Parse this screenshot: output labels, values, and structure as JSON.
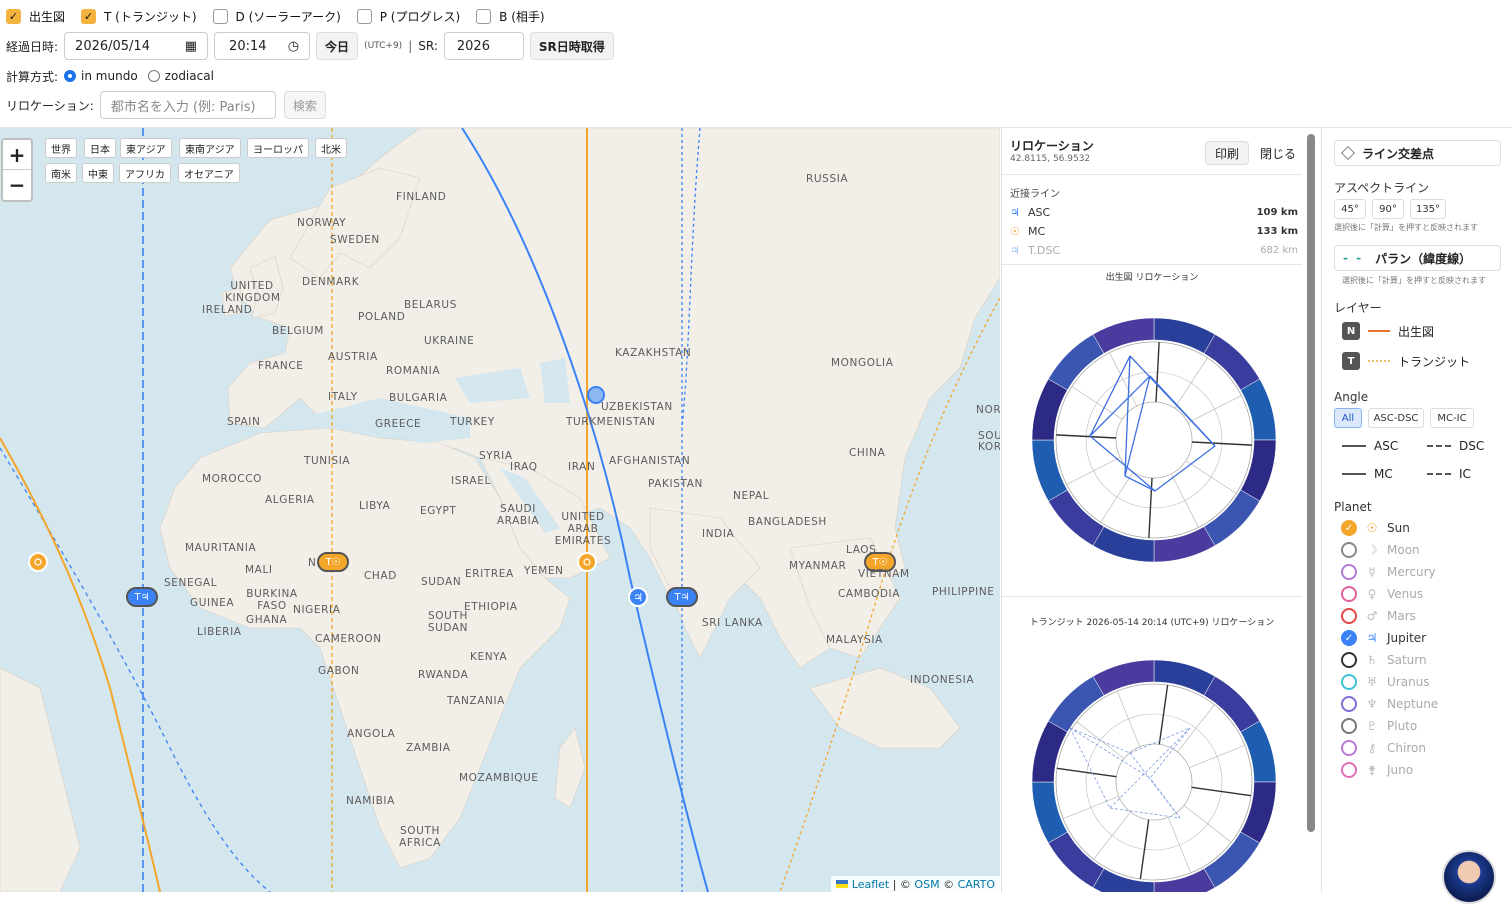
{
  "toolbar": {
    "chart_toggles": [
      {
        "label": "出生図",
        "checked": true
      },
      {
        "label": "T (トランジット)",
        "checked": true
      },
      {
        "label": "D (ソーラーアーク)",
        "checked": false
      },
      {
        "label": "P (プログレス)",
        "checked": false
      },
      {
        "label": "B (相手)",
        "checked": false
      }
    ],
    "date_label": "経過日時:",
    "date_value": "2026/05/14",
    "time_value": "20:14",
    "today_button": "今日",
    "tz": "(UTC+9)",
    "sep": "|",
    "sr_label": "SR:",
    "sr_value": "2026",
    "sr_button": "SR日時取得",
    "calc_label": "計算方式:",
    "calc_options": [
      "in mundo",
      "zodiacal"
    ],
    "reloc_label": "リロケーション:",
    "reloc_placeholder": "都市名を入力 (例: Paris)",
    "search_button": "検索"
  },
  "map": {
    "zoom_in": "+",
    "zoom_out": "−",
    "region_buttons_row1": [
      "世界",
      "日本",
      "東アジア",
      "東南アジア",
      "ヨーロッパ",
      "北米"
    ],
    "region_buttons_row2": [
      "南米",
      "中東",
      "アフリカ",
      "オセアニア"
    ],
    "labels": [
      "RUSSIA",
      "FINLAND",
      "NORWAY",
      "SWEDEN",
      "UNITED KINGDOM",
      "IRELAND",
      "DENMARK",
      "BELARUS",
      "POLAND",
      "UKRAINE",
      "BELGIUM",
      "FRANCE",
      "AUSTRIA",
      "ROMANIA",
      "ITALY",
      "BULGARIA",
      "GREECE",
      "SPAIN",
      "TURKEY",
      "KAZAKHSTAN",
      "UZBEKISTAN",
      "TURKMENISTAN",
      "MONGOLIA",
      "NOR",
      "SOU",
      "KOR",
      "CHINA",
      "TUNISIA",
      "SYRIA",
      "IRAQ",
      "IRAN",
      "AFGHANISTAN",
      "MOROCCO",
      "ALGERIA",
      "LIBYA",
      "EGYPT",
      "ISRAEL",
      "SAUDI ARABIA",
      "UNITED ARAB EMIRATES",
      "PAKISTAN",
      "NEPAL",
      "BANGLADESH",
      "INDIA",
      "MAURITANIA",
      "MALI",
      "NI",
      "CHAD",
      "SUDAN",
      "ERITREA",
      "YEMEN",
      "SENEGAL",
      "GUINEA",
      "BURKINA FASO",
      "NIGERIA",
      "ETHIOPIA",
      "SOUTH SUDAN",
      "GHANA",
      "LIBERIA",
      "CAMEROON",
      "GABON",
      "KENYA",
      "RWANDA",
      "TANZANIA",
      "ANGOLA",
      "ZAMBIA",
      "MOZAMBIQUE",
      "NAMIBIA",
      "SOUTH AFRICA",
      "MYANMAR",
      "LAOS",
      "VIETNAM",
      "CAMBODIA",
      "PHILIPPINE",
      "SRI LANKA",
      "MALAYSIA",
      "INDONESIA"
    ],
    "markers": [
      "T☉",
      "T♃",
      "T♃",
      "T☉"
    ],
    "attribution": {
      "leaflet": "Leaflet",
      "sep1": "| ©",
      "osm": "OSM",
      "sep2": "©",
      "carto": "CARTO"
    }
  },
  "relocation_panel": {
    "title": "リロケーション",
    "coords": "42.8115, 56.9532",
    "print_button": "印刷",
    "close_button": "閉じる",
    "nearby_title": "近接ライン",
    "nearby": [
      {
        "glyph": "♃",
        "name": "ASC",
        "dist": "109 km"
      },
      {
        "glyph": "☉",
        "name": "MC",
        "dist": "133 km"
      },
      {
        "glyph": "♃",
        "name": "T.DSC",
        "dist": "682 km"
      }
    ],
    "chart1_title": "出生図 リロケーション",
    "chart2_title": "トランジット 2026-05-14 20:14 (UTC+9) リロケーション"
  },
  "right_panel": {
    "intersect_button": "ライン交差点",
    "aspect_title": "アスペクトライン",
    "aspect_buttons": [
      "45°",
      "90°",
      "135°"
    ],
    "aspect_note": "選択後に「計算」を押すと反映されます",
    "paran_button": "パラン（緯度線）",
    "paran_note": "選択後に「計算」を押すと反映されます",
    "layer_title": "レイヤー",
    "layers": [
      {
        "badge": "N",
        "label": "出生図"
      },
      {
        "badge": "T",
        "label": "トランジット"
      }
    ],
    "angle_title": "Angle",
    "angle_buttons": [
      "All",
      "ASC-DSC",
      "MC-IC"
    ],
    "angle_legend": [
      "ASC",
      "DSC",
      "MC",
      "IC"
    ],
    "planet_title": "Planet",
    "planets": [
      {
        "name": "Sun",
        "glyph": "☉",
        "color": "#f4a62a",
        "on": true
      },
      {
        "name": "Moon",
        "glyph": "☽",
        "color": "#888888",
        "on": false
      },
      {
        "name": "Mercury",
        "glyph": "☿",
        "color": "#b47ad6",
        "on": false
      },
      {
        "name": "Venus",
        "glyph": "♀",
        "color": "#e0609a",
        "on": false
      },
      {
        "name": "Mars",
        "glyph": "♂",
        "color": "#e04848",
        "on": false
      },
      {
        "name": "Jupiter",
        "glyph": "♃",
        "color": "#3b82f6",
        "on": true
      },
      {
        "name": "Saturn",
        "glyph": "♄",
        "color": "#333333",
        "on": false
      },
      {
        "name": "Uranus",
        "glyph": "♅",
        "color": "#3fc1d6",
        "on": false
      },
      {
        "name": "Neptune",
        "glyph": "♆",
        "color": "#7c6fd6",
        "on": false
      },
      {
        "name": "Pluto",
        "glyph": "♇",
        "color": "#777777",
        "on": false
      },
      {
        "name": "Chiron",
        "glyph": "⚷",
        "color": "#b97ad6",
        "on": false
      },
      {
        "name": "Juno",
        "glyph": "⚵",
        "color": "#e06fb8",
        "on": false
      }
    ]
  }
}
